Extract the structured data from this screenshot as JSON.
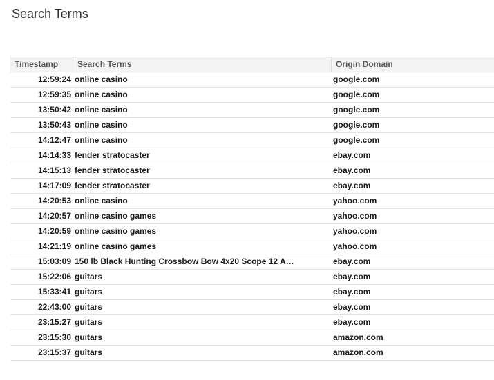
{
  "page": {
    "title": "Search Terms"
  },
  "table": {
    "columns": {
      "timestamp": "Timestamp",
      "search_terms": "Search Terms",
      "origin_domain": "Origin Domain"
    },
    "rows": [
      {
        "timestamp": "12:59:24",
        "term": "online casino",
        "domain": "google.com"
      },
      {
        "timestamp": "12:59:35",
        "term": "online casino",
        "domain": "google.com"
      },
      {
        "timestamp": "13:50:42",
        "term": "online casino",
        "domain": "google.com"
      },
      {
        "timestamp": "13:50:43",
        "term": "online casino",
        "domain": "google.com"
      },
      {
        "timestamp": "14:12:47",
        "term": "online casino",
        "domain": "google.com"
      },
      {
        "timestamp": "14:14:33",
        "term": "fender stratocaster",
        "domain": "ebay.com"
      },
      {
        "timestamp": "14:15:13",
        "term": "fender stratocaster",
        "domain": "ebay.com"
      },
      {
        "timestamp": "14:17:09",
        "term": "fender stratocaster",
        "domain": "ebay.com"
      },
      {
        "timestamp": "14:20:53",
        "term": "online casino",
        "domain": "yahoo.com"
      },
      {
        "timestamp": "14:20:57",
        "term": "online casino games",
        "domain": "yahoo.com"
      },
      {
        "timestamp": "14:20:59",
        "term": "online casino games",
        "domain": "yahoo.com"
      },
      {
        "timestamp": "14:21:19",
        "term": "online casino games",
        "domain": "yahoo.com"
      },
      {
        "timestamp": "15:03:09",
        "term": "150 lb Black Hunting Crossbow Bow 4x20 Scope 12 A…",
        "domain": "ebay.com"
      },
      {
        "timestamp": "15:22:06",
        "term": "guitars",
        "domain": "ebay.com"
      },
      {
        "timestamp": "15:33:41",
        "term": "guitars",
        "domain": "ebay.com"
      },
      {
        "timestamp": "22:43:00",
        "term": "guitars",
        "domain": "ebay.com"
      },
      {
        "timestamp": "23:15:27",
        "term": "guitars",
        "domain": "ebay.com"
      },
      {
        "timestamp": "23:15:30",
        "term": "guitars",
        "domain": "amazon.com"
      },
      {
        "timestamp": "23:15:37",
        "term": "guitars",
        "domain": "amazon.com"
      }
    ]
  }
}
